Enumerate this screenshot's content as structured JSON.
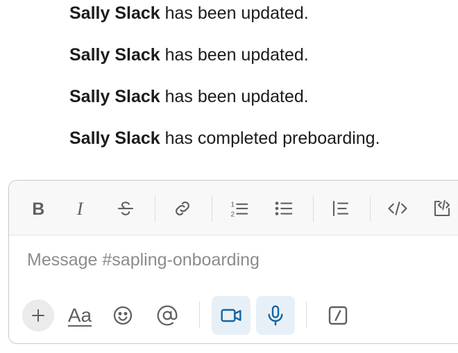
{
  "messages": [
    {
      "name": "Sally Slack",
      "text": "has been updated."
    },
    {
      "name": "Sally Slack",
      "text": "has been updated."
    },
    {
      "name": "Sally Slack",
      "text": "has been updated."
    },
    {
      "name": "Sally Slack",
      "text": "has completed preboarding."
    }
  ],
  "composer": {
    "placeholder": "Message #sapling-onboarding",
    "formatting_toolbar": [
      "bold-icon",
      "italic-icon",
      "strikethrough-icon",
      "link-icon",
      "ordered-list-icon",
      "bulleted-list-icon",
      "blockquote-icon",
      "code-icon",
      "code-block-icon"
    ],
    "bottom_toolbar": {
      "text_format_label": "Aa",
      "icons": [
        "plus-icon",
        "emoji-icon",
        "mention-icon",
        "video-clip-icon",
        "microphone-icon",
        "slash-command-icon"
      ]
    },
    "accent_color": "#1264a3",
    "active_bg": "#e8f0f7"
  }
}
